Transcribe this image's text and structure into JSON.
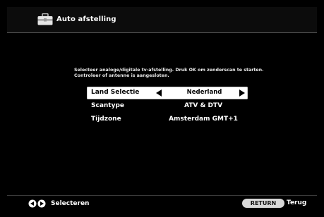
{
  "header": {
    "icon": "toolbox-icon",
    "title": "Auto afstelling"
  },
  "instruction": {
    "line1": "Selecteer analoge/digitale tv-afstelling. Druk OK om zenderscan te starten.",
    "line2": "Controleer of antenne is aangesloten."
  },
  "settings": [
    {
      "label": "Land Selectie",
      "value": "Nederland",
      "selected": true
    },
    {
      "label": "Scantype",
      "value": "ATV & DTV",
      "selected": false
    },
    {
      "label": "Tijdzone",
      "value": "Amsterdam GMT+1",
      "selected": false
    }
  ],
  "footer": {
    "nav_icon": "left-right-arrows-icon",
    "nav_label": "Selecteren",
    "return_button": "RETURN",
    "back_label": "Terug"
  },
  "colors": {
    "background": "#000000",
    "title_bar": "#0c0c0c",
    "selected_row": "#ffffff",
    "return_button": "#d8d8d8"
  }
}
